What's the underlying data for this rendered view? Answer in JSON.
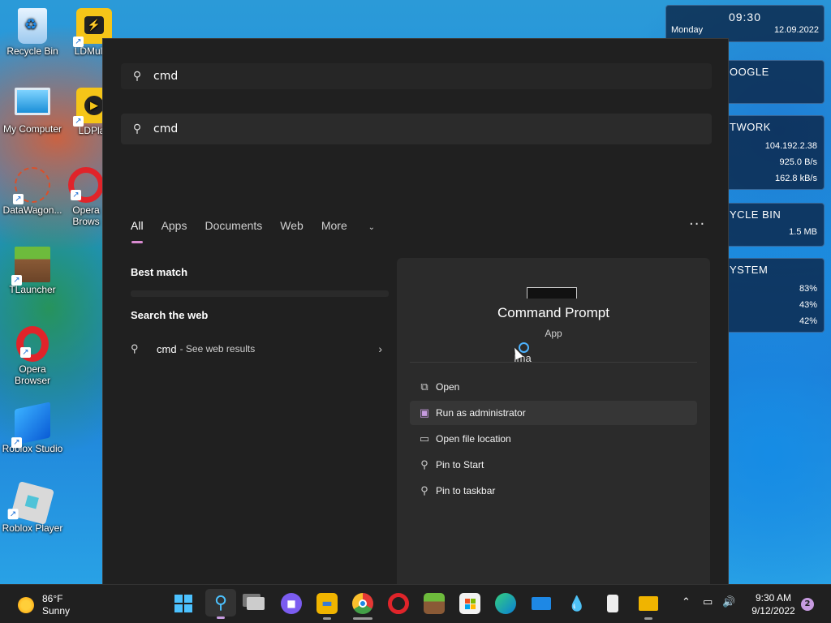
{
  "desktop": {
    "icons": [
      {
        "label": "Recycle Bin"
      },
      {
        "label": "LDMultiP"
      },
      {
        "label": "My Computer"
      },
      {
        "label": "LDPlay"
      },
      {
        "label": "DataWagon..."
      },
      {
        "label": "Opera Brows"
      },
      {
        "label": "TLauncher"
      },
      {
        "label": "Opera Browser"
      },
      {
        "label": "Roblox Studio"
      },
      {
        "label": "Roblox Player"
      }
    ]
  },
  "widgets": {
    "clock": {
      "time": "09:30",
      "day": "Monday",
      "date": "12.09.2022"
    },
    "google": {
      "title": "OOGLE"
    },
    "network": {
      "title": "TWORK",
      "ip": "104.192.2.38",
      "up": "925.0 B/s",
      "down": "162.8 kB/s"
    },
    "recycle": {
      "title": "YCLE BIN",
      "size": "1.5 MB"
    },
    "system": {
      "title": "YSTEM",
      "cpu": "83%",
      "ram": "43%",
      "disk": "42%"
    }
  },
  "search": {
    "query_top": "cmd",
    "query": "cmd",
    "filters": [
      "All",
      "Apps",
      "Documents",
      "Web",
      "More"
    ],
    "best_match_label": "Best match",
    "web_label": "Search the web",
    "web_result": {
      "term": "cmd",
      "suffix": "- See web results"
    }
  },
  "detail": {
    "app_name": "Command Prompt",
    "app_type": "App",
    "ghost_text": "Ima",
    "actions": [
      {
        "label": "Open",
        "icon": "open-icon"
      },
      {
        "label": "Run as administrator",
        "icon": "shield-icon"
      },
      {
        "label": "Open file location",
        "icon": "folder-icon"
      },
      {
        "label": "Pin to Start",
        "icon": "pin-icon"
      },
      {
        "label": "Pin to taskbar",
        "icon": "pin-icon"
      }
    ]
  },
  "taskbar": {
    "weather": {
      "temp": "86°F",
      "cond": "Sunny"
    },
    "clock": {
      "time": "9:30 AM",
      "date": "9/12/2022"
    },
    "notifications": "2"
  },
  "colors": {
    "accent": "#d88ad0",
    "panel": "#202020",
    "detail": "#2b2b2b"
  }
}
